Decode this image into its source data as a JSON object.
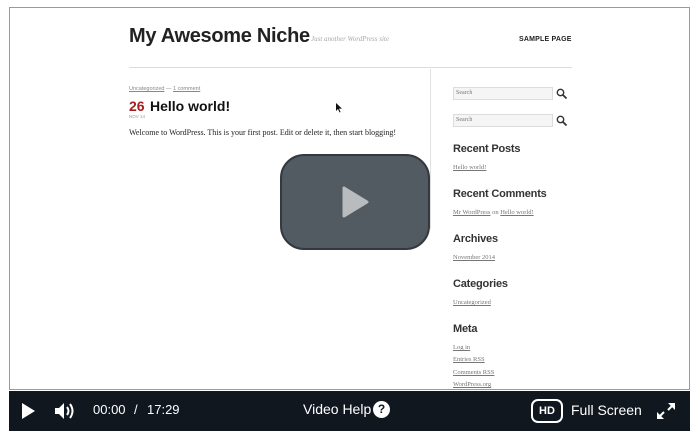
{
  "site": {
    "title": "My Awesome Niche",
    "tagline": "Just another WordPress site",
    "nav_item": "SAMPLE PAGE"
  },
  "post": {
    "category": "Uncategorized",
    "separator": "—",
    "comments": "1 comment",
    "day": "26",
    "month": "NOV 14",
    "title": "Hello world!",
    "body": "Welcome to WordPress. This is your first post. Edit or delete it, then start blogging!"
  },
  "sidebar": {
    "search_placeholder_1": "Search",
    "search_placeholder_2": "Search",
    "recent_posts_title": "Recent Posts",
    "recent_posts": [
      "Hello world!"
    ],
    "recent_comments_title": "Recent Comments",
    "recent_comment": {
      "author": "Mr WordPress",
      "on": "on",
      "post": "Hello world!"
    },
    "archives_title": "Archives",
    "archives": [
      "November 2014"
    ],
    "categories_title": "Categories",
    "categories": [
      "Uncategorized"
    ],
    "meta_title": "Meta",
    "meta_links": [
      "Log in",
      "Entries RSS",
      "Comments RSS",
      "WordPress.org"
    ]
  },
  "player": {
    "current_time": "00:00",
    "time_separator": "/",
    "duration": "17:29",
    "help_label": "Video Help",
    "help_icon_glyph": "?",
    "hd_label": "HD",
    "fullscreen_label": "Full Screen"
  },
  "colors": {
    "control_bar_bg": "#10171f",
    "play_overlay_bg": "#525a62",
    "post_day_accent": "#a51d1d"
  }
}
